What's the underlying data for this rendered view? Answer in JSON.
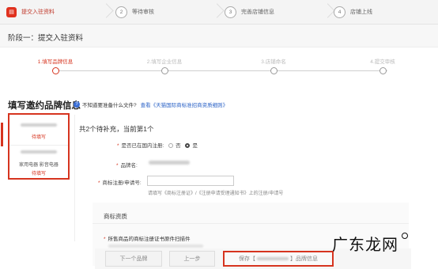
{
  "top_steps": [
    {
      "num": "",
      "label": "提交入驻资料",
      "active": true
    },
    {
      "num": "2",
      "label": "等待审核",
      "active": false
    },
    {
      "num": "3",
      "label": "完善店铺信息",
      "active": false
    },
    {
      "num": "4",
      "label": "店铺上线",
      "active": false
    }
  ],
  "stage": {
    "title": "阶段一：提交入驻资料"
  },
  "progress": [
    {
      "label": "1.填写品牌信息",
      "active": true
    },
    {
      "label": "2.填写企业信息",
      "active": false
    },
    {
      "label": "3.店铺命名",
      "active": false
    },
    {
      "label": "4.提交审核",
      "active": false
    }
  ],
  "heading": "填写邀约品牌信息",
  "help": {
    "text": "不知道要准备什么文件?",
    "link": "查看《天猫国际商标准招商资质细则》"
  },
  "brand_list": [
    {
      "status": "待填写",
      "category": ""
    },
    {
      "status": "待填写",
      "category": "家用电器 影音电器"
    }
  ],
  "counter": "共2个待补充，当前第1个",
  "form": {
    "registered_label": "是否已在国内注册:",
    "opt_no": "否",
    "opt_yes": "是",
    "brand_label": "品牌名:",
    "trademark_label": "商标注册/申请号:",
    "trademark_value": "",
    "trademark_hint": "请填写《商标注册证》/《注册申请受理通知书》上的注册/申请号"
  },
  "qualification": {
    "title": "商标资质",
    "cert_label": "所售商品的商标注册证书原件扫描件"
  },
  "buttons": {
    "next": "下一个品牌",
    "prev": "上一步",
    "save_prefix": "保存【",
    "save_suffix": "】品牌信息"
  },
  "watermark": "广东龙网",
  "colors": {
    "accent": "#d6341f",
    "link": "#2d64c7"
  }
}
